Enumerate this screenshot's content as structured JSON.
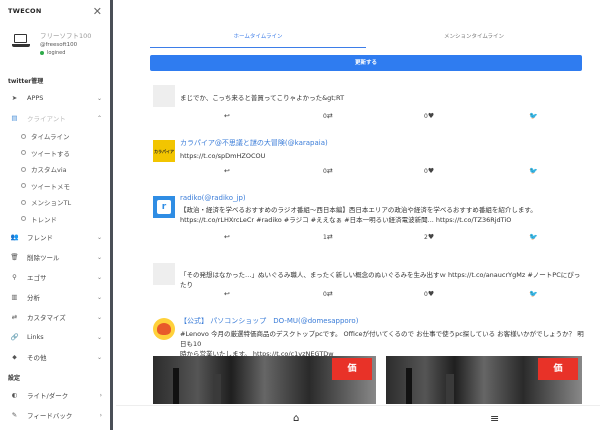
{
  "app": {
    "brand": "TWECON"
  },
  "user": {
    "name": "フリーソフト100",
    "handle": "@freesoft100",
    "status": "logined"
  },
  "sidebar": {
    "section1": "twitter管理",
    "section2": "設定",
    "apps": "APPS",
    "client": "クライアント",
    "sub": [
      "タイムライン",
      "ツイートする",
      "カスタムvia",
      "ツイートメモ",
      "メンションTL",
      "トレンド"
    ],
    "items": [
      "フレンド",
      "削除ツール",
      "エゴサ",
      "分析",
      "カスタマイズ",
      "Links",
      "その他"
    ],
    "settings": [
      "ライト/ダーク",
      "フィードバック"
    ]
  },
  "tabs": {
    "home": "ホームタイムライン",
    "mention": "メンションタイムライン"
  },
  "refresh_label": "更新する",
  "posts": [
    {
      "name": "",
      "text": "まじでか、こっち来ると普買ってこりゃよかった&gt;RT",
      "retweets": "0",
      "likes": "0"
    },
    {
      "name": "カラパイア@不思議と謎の大冒険(@karapaia)",
      "text": "https://t.co/spDmHZOCOU",
      "retweets": "0",
      "likes": "0"
    },
    {
      "name": "radiko(@radiko_jp)",
      "text": "【政治・経済を学べるおすすめのラジオ番組〜西日本編】西日本エリアの政治や経済を学べるおすすめ番組を紹介します。",
      "text2": "https://t.co/rLHXrcLeCr #radiko #ラジコ #ええなぁ #日本一明るい経済電波新聞... https://t.co/TZ36RjdTiO",
      "retweets": "1",
      "likes": "2"
    },
    {
      "name": "",
      "text": "「その発想はなかった…」ぬいぐるみ職人、まったく新しい概念のぬいぐるみを生み出すｗ https://t.co/anaucrYgMz #ノートPCにぴったり",
      "retweets": "0",
      "likes": "0"
    },
    {
      "name": "【公式】 パソコンショップ　DO-MU(@domesapporo)",
      "text": "#Lenovo 今月の厳選特価商品のデスクトップpcです。 Officeが付いてくるので お仕事で使うpc探している お客様いかがでしょうか？ 明日も10",
      "text2": "時から営業いたします。 https://t.co/c1yzNEGTDw"
    }
  ],
  "avatars": {
    "karapaia": "カラパイア",
    "radiko": "r"
  },
  "image_price": "価"
}
